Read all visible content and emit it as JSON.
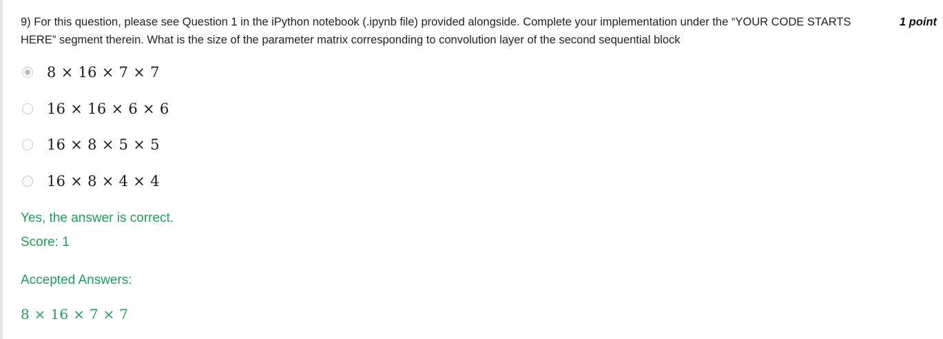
{
  "question": {
    "text": "9) For this question, please see Question 1 in the iPython notebook (.ipynb file) provided alongside. Complete your implementation under the “YOUR CODE STARTS HERE” segment therein. What is the size of the parameter matrix corresponding to convolution layer of the second sequential block",
    "points": "1 point"
  },
  "options": [
    {
      "label": "8 × 16 × 7 × 7",
      "selected": true
    },
    {
      "label": "16 × 16 × 6 × 6",
      "selected": false
    },
    {
      "label": "16 × 8 × 5 × 5",
      "selected": false
    },
    {
      "label": "16 × 8 × 4 × 4",
      "selected": false
    }
  ],
  "feedback": {
    "result": "Yes, the answer is correct.",
    "score": "Score: 1",
    "accepted_heading": "Accepted Answers:",
    "accepted_answer": "8 × 16 × 7 × 7"
  },
  "colors": {
    "correct_green": "#1e9c5b",
    "text": "#222222"
  }
}
